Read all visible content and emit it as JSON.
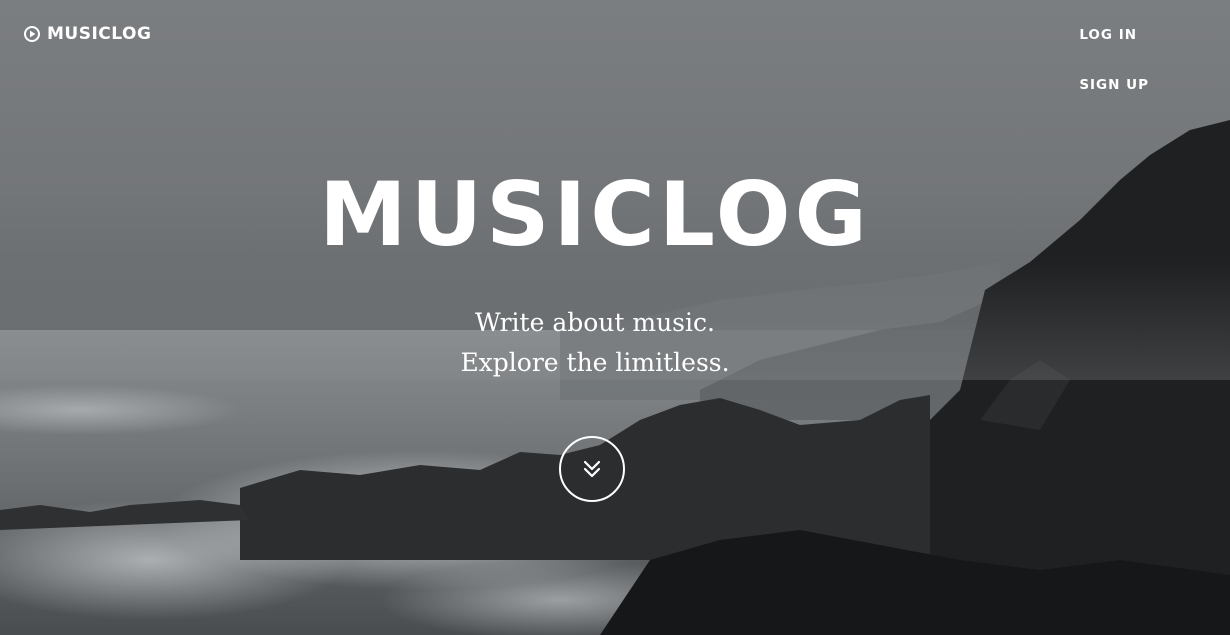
{
  "nav": {
    "brand_label": "MUSICLOG",
    "brand_icon": "play-circle-icon",
    "links": [
      {
        "label": "LOG IN"
      },
      {
        "label": "SIGN UP"
      }
    ]
  },
  "hero": {
    "title": "MUSICLOG",
    "tagline_line1": "Write about music.",
    "tagline_line2": "Explore the limitless.",
    "scroll_icon": "double-chevron-down-icon"
  },
  "colors": {
    "text": "#ffffff",
    "sky": "#7b7e80",
    "rock": "#1d1e1f",
    "surf": "#cfd2d3"
  }
}
